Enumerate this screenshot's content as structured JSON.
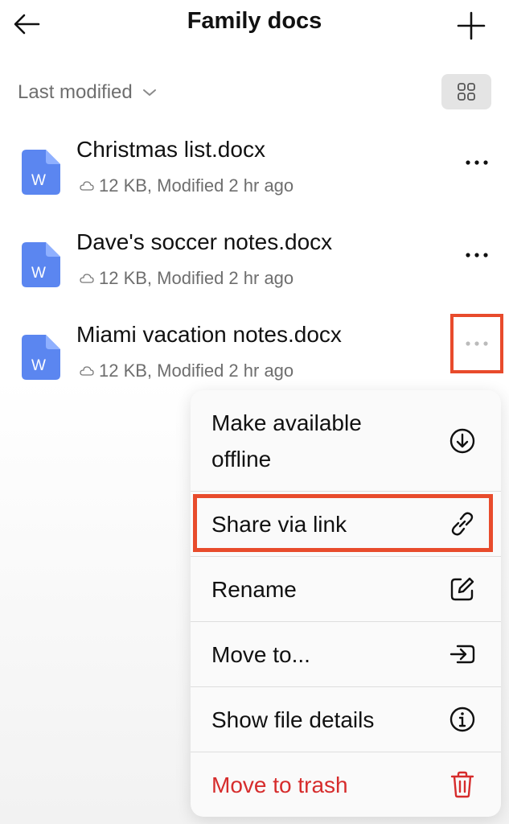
{
  "header": {
    "title": "Family docs"
  },
  "sort": {
    "label": "Last modified"
  },
  "files": [
    {
      "name": "Christmas list.docx",
      "meta": "12 KB, Modified 2 hr ago",
      "icon_letter": "W"
    },
    {
      "name": "Dave's soccer notes.docx",
      "meta": "12 KB, Modified 2 hr ago",
      "icon_letter": "W"
    },
    {
      "name": "Miami vacation notes.docx",
      "meta": "12 KB, Modified 2 hr ago",
      "icon_letter": "W"
    }
  ],
  "menu": {
    "items": [
      {
        "label_line1": "Make available",
        "label_line2": "offline",
        "icon": "download-circle-icon"
      },
      {
        "label": "Share via link",
        "icon": "link-icon"
      },
      {
        "label": "Rename",
        "icon": "edit-icon"
      },
      {
        "label": "Move to...",
        "icon": "move-icon"
      },
      {
        "label": "Show file details",
        "icon": "info-icon"
      },
      {
        "label": "Move to trash",
        "icon": "trash-icon"
      }
    ]
  },
  "colors": {
    "accent": "#e84b2c",
    "danger": "#d62c2c",
    "word_blue": "#5b86f0"
  }
}
